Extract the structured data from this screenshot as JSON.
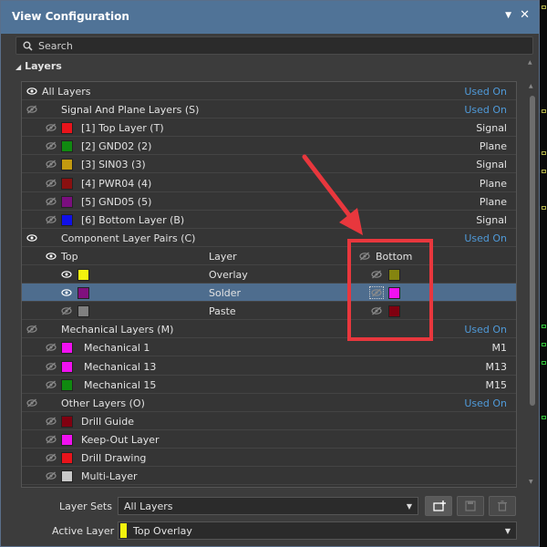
{
  "window": {
    "title": "View Configuration",
    "pin": "▼",
    "close": "✕"
  },
  "search": {
    "placeholder": "Search"
  },
  "layers_section": {
    "label": "Layers"
  },
  "colors": {
    "accent": "#4f9ad9",
    "title_bar": "#507397",
    "highlight_box": "#e8373d"
  },
  "rows": [
    {
      "kind": "group",
      "icon": "eye-visible",
      "label": "All Layers",
      "right": "Used On"
    },
    {
      "kind": "group",
      "icon": "eye-hidden",
      "label": "Signal And Plane Layers (S)",
      "right": "Used On"
    },
    {
      "kind": "layer",
      "icon": "eye-hidden",
      "color": "#e8141b",
      "label": "[1] Top Layer (T)",
      "right": "Signal"
    },
    {
      "kind": "layer",
      "icon": "eye-hidden",
      "color": "#108a10",
      "label": "[2] GND02 (2)",
      "right": "Plane"
    },
    {
      "kind": "layer",
      "icon": "eye-hidden",
      "color": "#c29a10",
      "label": "[3] SIN03 (3)",
      "right": "Signal"
    },
    {
      "kind": "layer",
      "icon": "eye-hidden",
      "color": "#8a1010",
      "label": "[4] PWR04 (4)",
      "right": "Plane"
    },
    {
      "kind": "layer",
      "icon": "eye-hidden",
      "color": "#7a0e7e",
      "label": "[5] GND05 (5)",
      "right": "Plane"
    },
    {
      "kind": "layer",
      "icon": "eye-hidden",
      "color": "#1010e8",
      "label": "[6] Bottom Layer (B)",
      "right": "Signal"
    },
    {
      "kind": "group",
      "icon": "eye-visible",
      "label": "Component Layer Pairs (C)",
      "right": "Used On"
    },
    {
      "kind": "pairhead",
      "top": "Top",
      "layer": "Layer",
      "bottom": "Bottom"
    },
    {
      "kind": "pair",
      "top_icon": "eye-visible",
      "top_color": "#f2f20e",
      "label": "Overlay",
      "bottom_icon": "eye-hidden",
      "bottom_color": "#848410"
    },
    {
      "kind": "pair",
      "top_icon": "eye-visible",
      "top_color": "#80107e",
      "label": "Solder",
      "bottom_icon": "eye-hidden",
      "bottom_color": "#f010f0",
      "selected": true
    },
    {
      "kind": "pair",
      "top_icon": "eye-hidden",
      "top_color": "#808080",
      "label": "Paste",
      "bottom_icon": "eye-hidden",
      "bottom_color": "#800010"
    },
    {
      "kind": "group",
      "icon": "eye-hidden",
      "label": "Mechanical Layers (M)",
      "right": "Used On"
    },
    {
      "kind": "layer",
      "icon": "eye-hidden",
      "color": "#f010f0",
      "label": "Mechanical 1",
      "right": "M1"
    },
    {
      "kind": "layer",
      "icon": "eye-hidden",
      "color": "#f010f0",
      "label": "Mechanical 13",
      "right": "M13"
    },
    {
      "kind": "layer",
      "icon": "eye-hidden",
      "color": "#108a10",
      "label": "Mechanical 15",
      "right": "M15"
    },
    {
      "kind": "group",
      "icon": "eye-hidden",
      "label": "Other Layers (O)",
      "right": "Used On"
    },
    {
      "kind": "layer",
      "icon": "eye-hidden",
      "color": "#800010",
      "label": "Drill Guide",
      "right": ""
    },
    {
      "kind": "layer",
      "icon": "eye-hidden",
      "color": "#f010f0",
      "label": "Keep-Out Layer",
      "right": ""
    },
    {
      "kind": "layer",
      "icon": "eye-hidden",
      "color": "#e8141b",
      "label": "Drill Drawing",
      "right": ""
    },
    {
      "kind": "layer",
      "icon": "eye-hidden",
      "color": "#c8c8c8",
      "label": "Multi-Layer",
      "right": ""
    }
  ],
  "layer_sets": {
    "label": "Layer Sets",
    "value": "All Layers"
  },
  "active_layer": {
    "label": "Active Layer",
    "value": "Top Overlay",
    "color": "#f2f20e"
  }
}
